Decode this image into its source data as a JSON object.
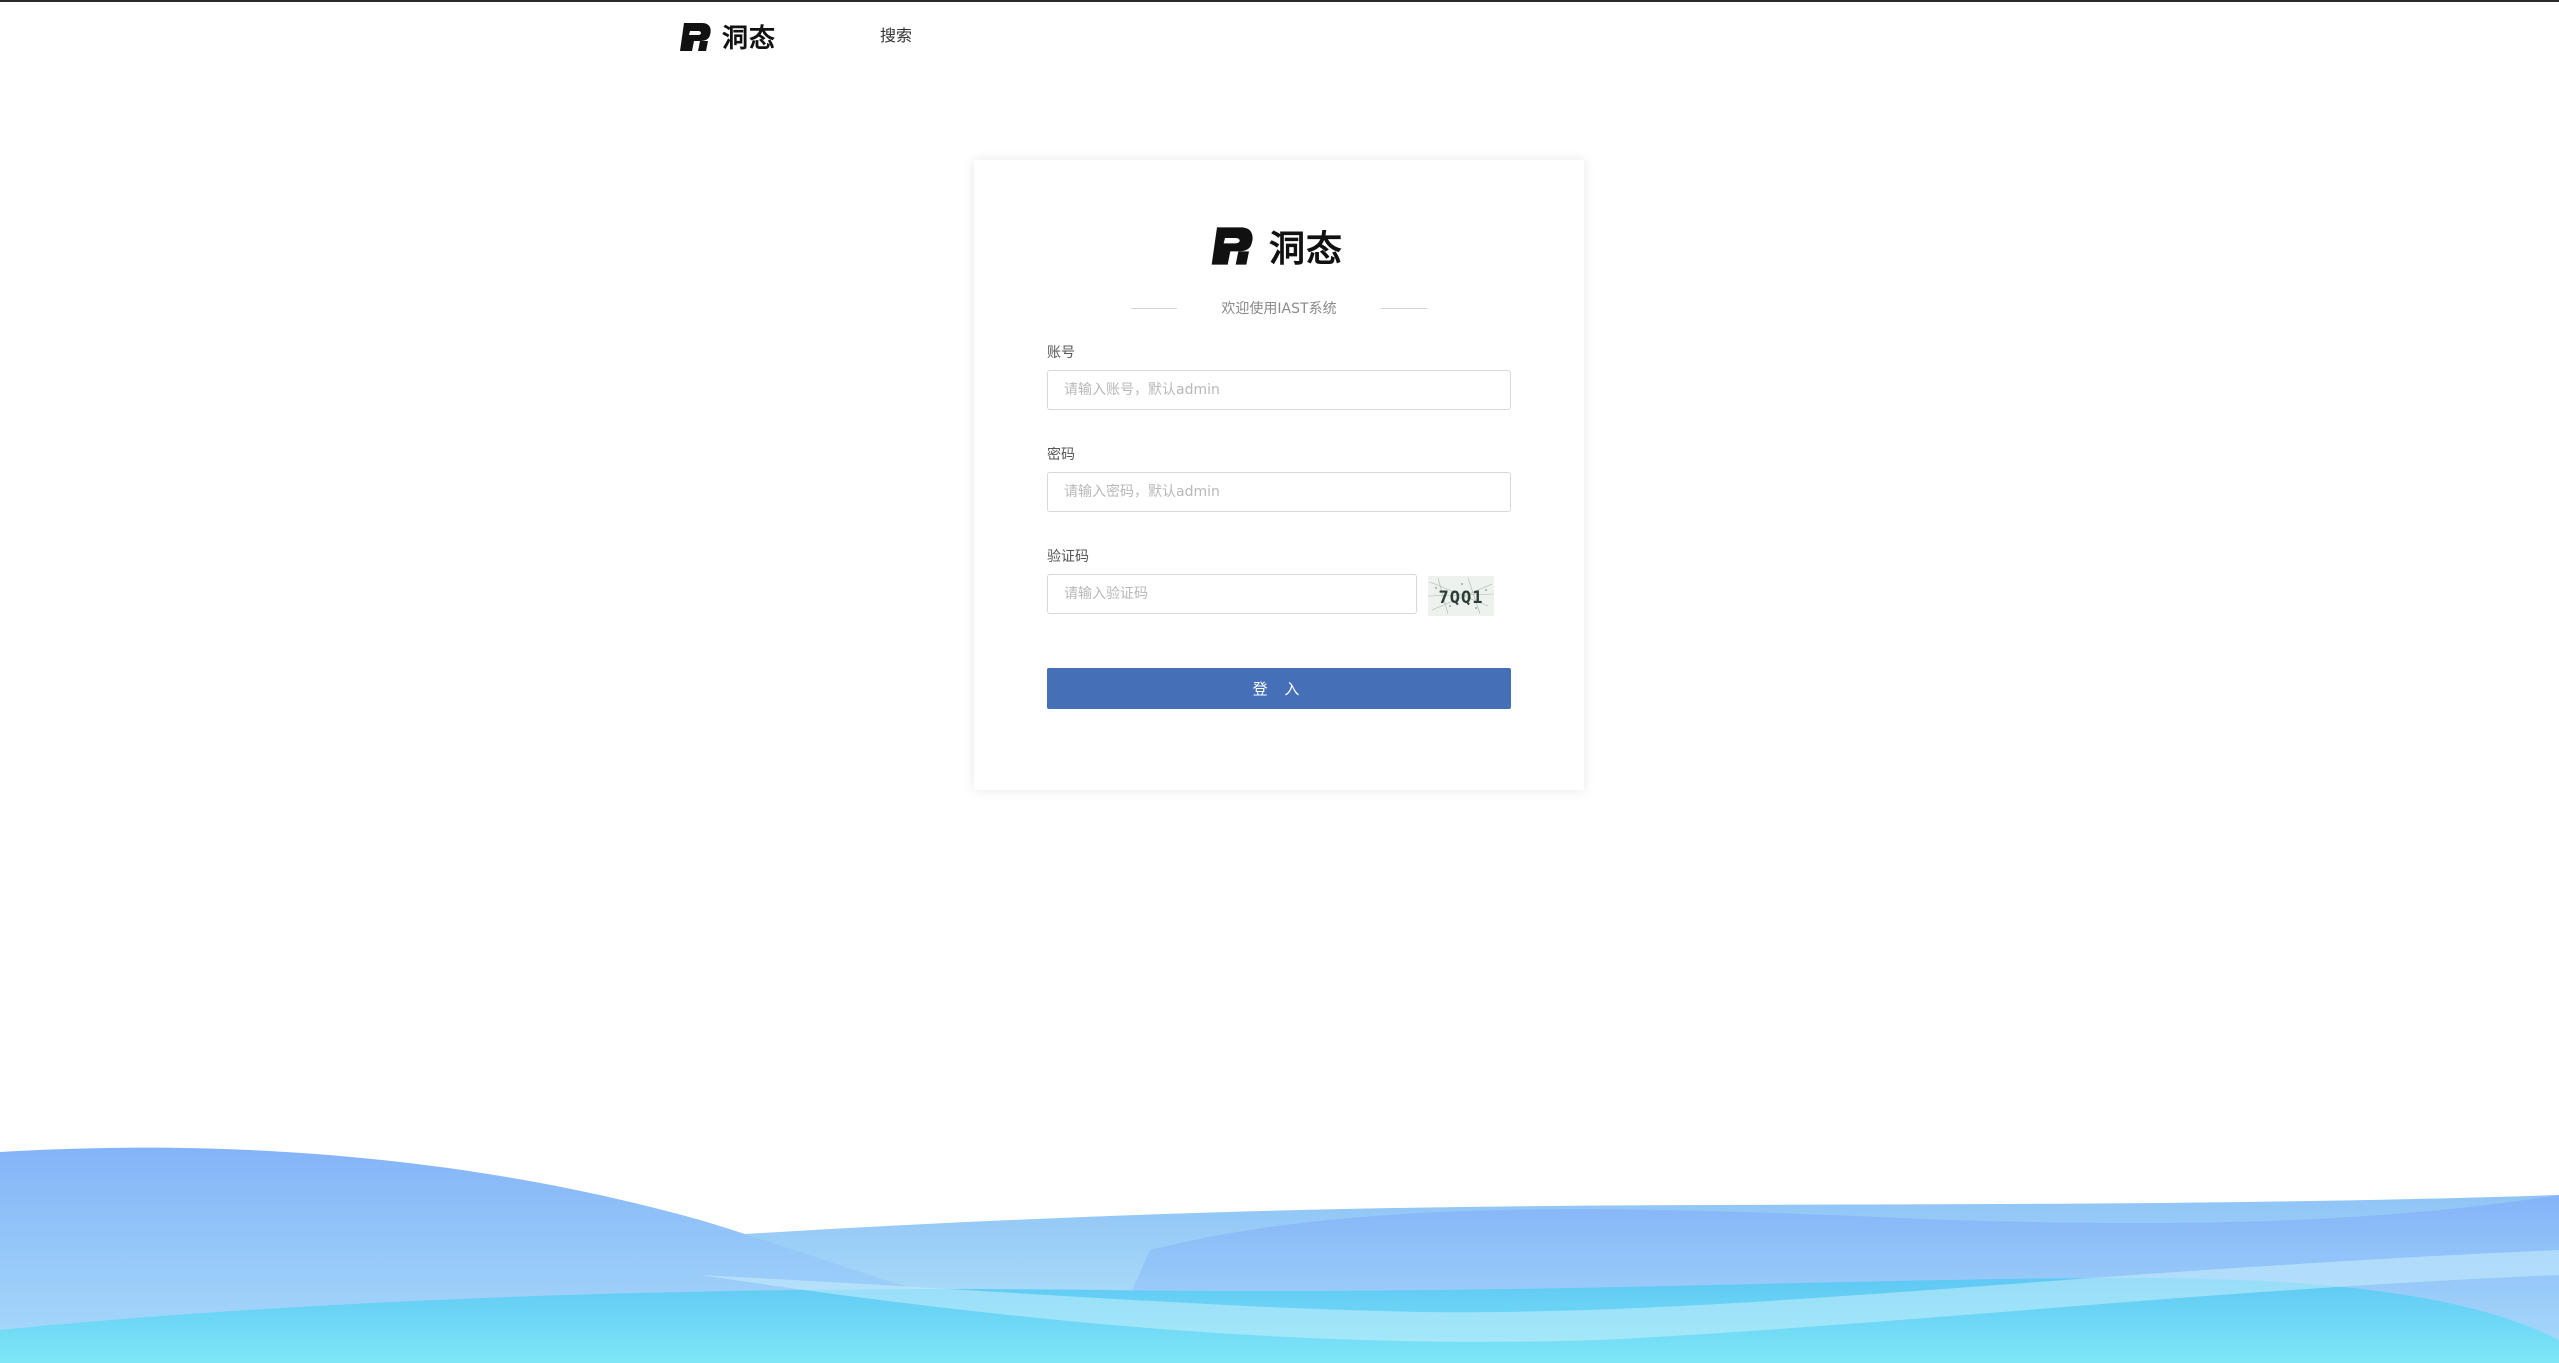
{
  "header": {
    "logo_text": "洞态",
    "nav_search": "搜索"
  },
  "card": {
    "logo_text": "洞态",
    "welcome": "欢迎使用IAST系统",
    "account_label": "账号",
    "account_placeholder": "请输入账号，默认admin",
    "password_label": "密码",
    "password_placeholder": "请输入密码，默认admin",
    "captcha_label": "验证码",
    "captcha_placeholder": "请输入验证码",
    "captcha_text": "7QQ1",
    "login_button": "登 入"
  },
  "colors": {
    "primary_button": "#4570b8",
    "wave_top": "#8ab8f8",
    "wave_bottom": "#6fe3f5"
  }
}
